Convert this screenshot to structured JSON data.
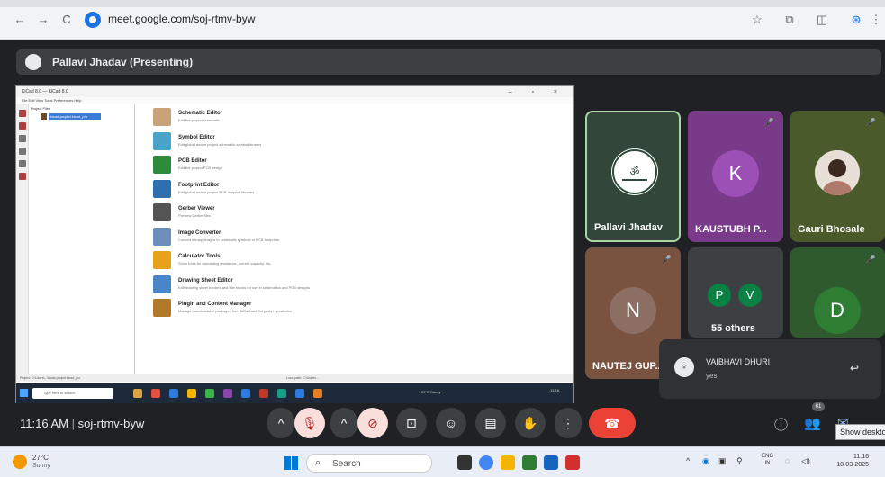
{
  "browser": {
    "url": "meet.google.com/soj-rtmv-byw",
    "nav_back": "←",
    "nav_forward": "→",
    "nav_reload": "C",
    "star": "☆",
    "icon_ext": "⧉",
    "icon_reader": "◫",
    "icon_profile": "⊛",
    "icon_menu": "⋮"
  },
  "meet": {
    "presenter_label": "Pallavi Jhadav (Presenting)",
    "meeting_time": "11:16 AM",
    "meeting_code": "soj-rtmv-byw",
    "participants_badge": "61",
    "tooltip": "Show desktop"
  },
  "shared_screen": {
    "title": "KiCad 8.0 — KiCad 8.0",
    "window_controls": "– ▫ ×",
    "menu": "File  Edit  View  Tools  Preferences  Help",
    "tree_header": "Project Files",
    "tree_item": "kicad-project.kicad_pro",
    "apps": [
      {
        "name": "Schematic Editor",
        "desc": "Edit the project schematic",
        "color": "#c9a27a"
      },
      {
        "name": "Symbol Editor",
        "desc": "Edit global and/or project schematic symbol libraries",
        "color": "#4aa3c8"
      },
      {
        "name": "PCB Editor",
        "desc": "Edit the project PCB design",
        "color": "#2e8b3a"
      },
      {
        "name": "Footprint Editor",
        "desc": "Edit global and/or project PCB footprint libraries",
        "color": "#2f6fb0"
      },
      {
        "name": "Gerber Viewer",
        "desc": "Preview Gerber files",
        "color": "#555555"
      },
      {
        "name": "Image Converter",
        "desc": "Convert bitmap images to schematic symbols or PCB footprints",
        "color": "#6b8fb8"
      },
      {
        "name": "Calculator Tools",
        "desc": "Show tools for calculating resistance, current capacity, etc.",
        "color": "#e6a21a"
      },
      {
        "name": "Drawing Sheet Editor",
        "desc": "Edit drawing sheet borders and title blocks for use in schematics and PCB designs",
        "color": "#4a86c7"
      },
      {
        "name": "Plugin and Content Manager",
        "desc": "Manage downloadable packages from KiCad and 3rd party repositories",
        "color": "#b07a2a"
      }
    ],
    "status": "Project: C:\\Users\\...\\kicad-project.kicad_pro",
    "status_right": "Local path: C:\\Users\\...",
    "taskbar_search": "Type here to search",
    "taskbar_weather": "29°C Sunny",
    "taskbar_clock": "11:16"
  },
  "tiles": [
    {
      "name": "Pallavi Jhadav",
      "bg": "#32473a",
      "border": "#a8d5a2"
    },
    {
      "name": "KAUSTUBH P...",
      "initial": "K",
      "bg": "#7a3a8a",
      "avatar_bg": "#9c4fb5"
    },
    {
      "name": "Gauri Bhosale",
      "bg": "#4a5a2a"
    },
    {
      "name": "NAUTEJ GUP...",
      "initial": "N",
      "bg": "#7a5240",
      "avatar_bg": "#8d6e63"
    },
    {
      "others_label": "55 others",
      "initials": [
        "P",
        "V"
      ],
      "bg": "#3c4043"
    },
    {
      "initial": "D",
      "bg": "#2e5a2e",
      "avatar_bg": "#2e7d32"
    }
  ],
  "toast": {
    "sender": "VAIBHAVI DHURI",
    "message": "yes",
    "reply_icon": "↩"
  },
  "controls": {
    "chevron": "^",
    "mic_icon": "🎙",
    "cam_icon": "⊘",
    "present_icon": "⊡",
    "emoji_icon": "☺",
    "captions_icon": "▤",
    "hand_icon": "✋",
    "more_icon": "⋮",
    "end_icon": "☎",
    "info_icon": "ⓘ",
    "people_icon": "👥",
    "chat_icon": "✉"
  },
  "taskbar": {
    "temp": "27°C",
    "weather": "Sunny",
    "search": "Search",
    "lang_top": "ENG",
    "lang_bottom": "IN",
    "time": "11:16",
    "date": "18-03-2025"
  }
}
